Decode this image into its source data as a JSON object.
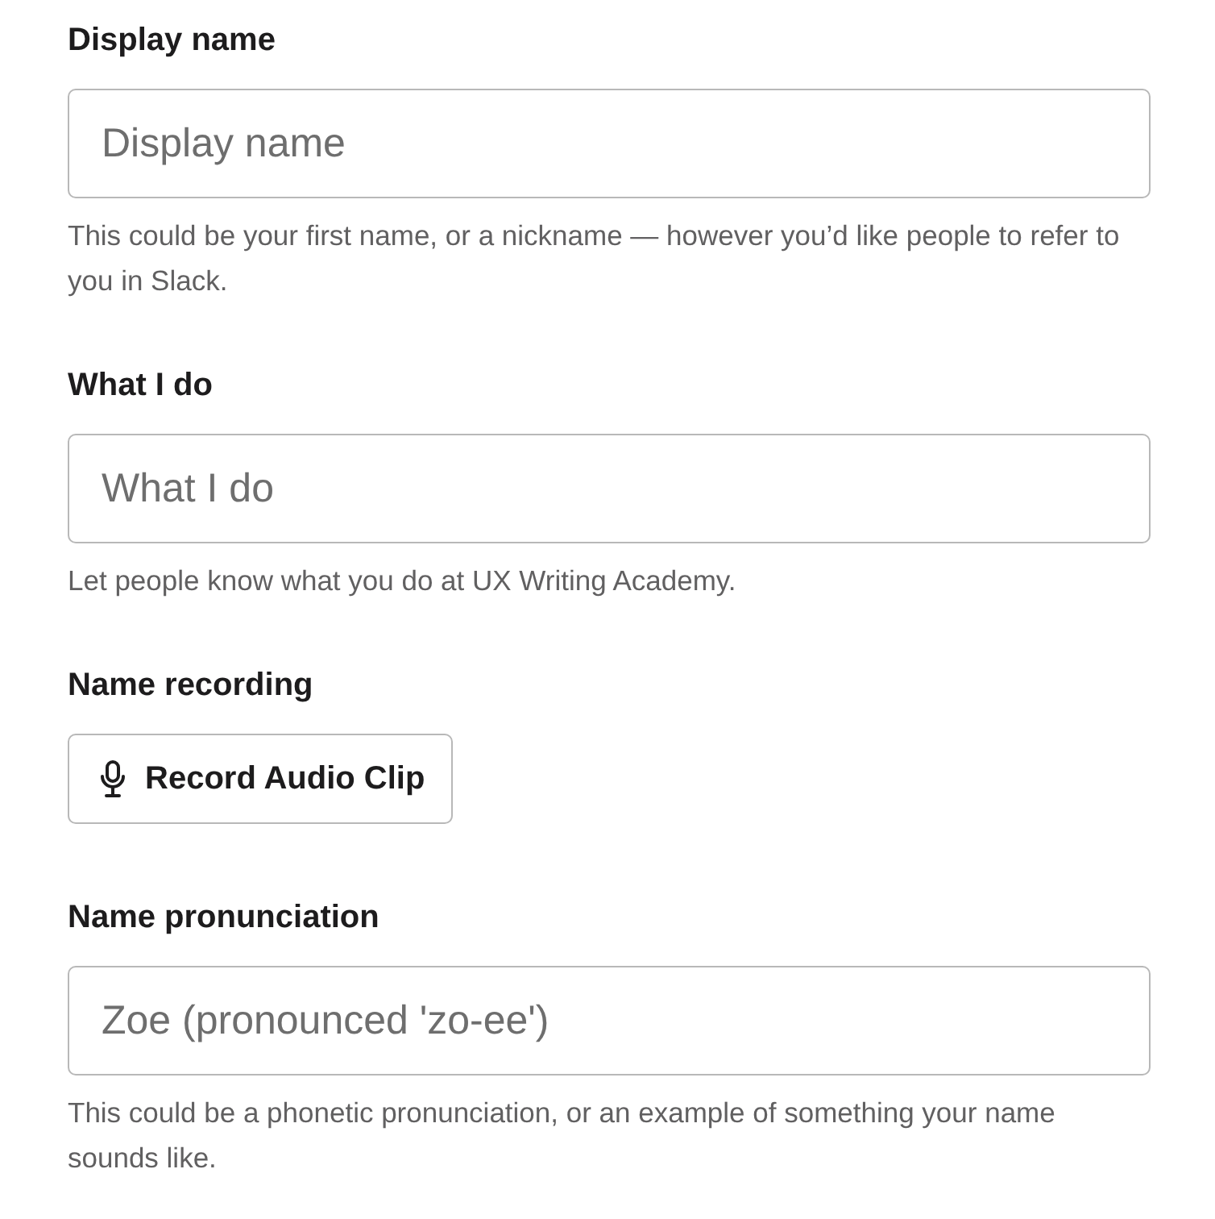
{
  "fields": [
    {
      "kind": "text",
      "label": "Display name",
      "placeholder": "Display name",
      "help": "This could be your first name, or a nickname — however you’d like people to refer to you in Slack."
    },
    {
      "kind": "text",
      "label": "What I do",
      "placeholder": "What I do",
      "help": "Let people know what you do at UX Writing Academy."
    },
    {
      "kind": "button",
      "label": "Name recording",
      "button": "Record Audio Clip"
    },
    {
      "kind": "text",
      "label": "Name pronunciation",
      "placeholder": "Zoe (pronounced 'zo-ee')",
      "help": "This could be a phonetic pronunciation, or an example of something your name sounds like."
    }
  ]
}
